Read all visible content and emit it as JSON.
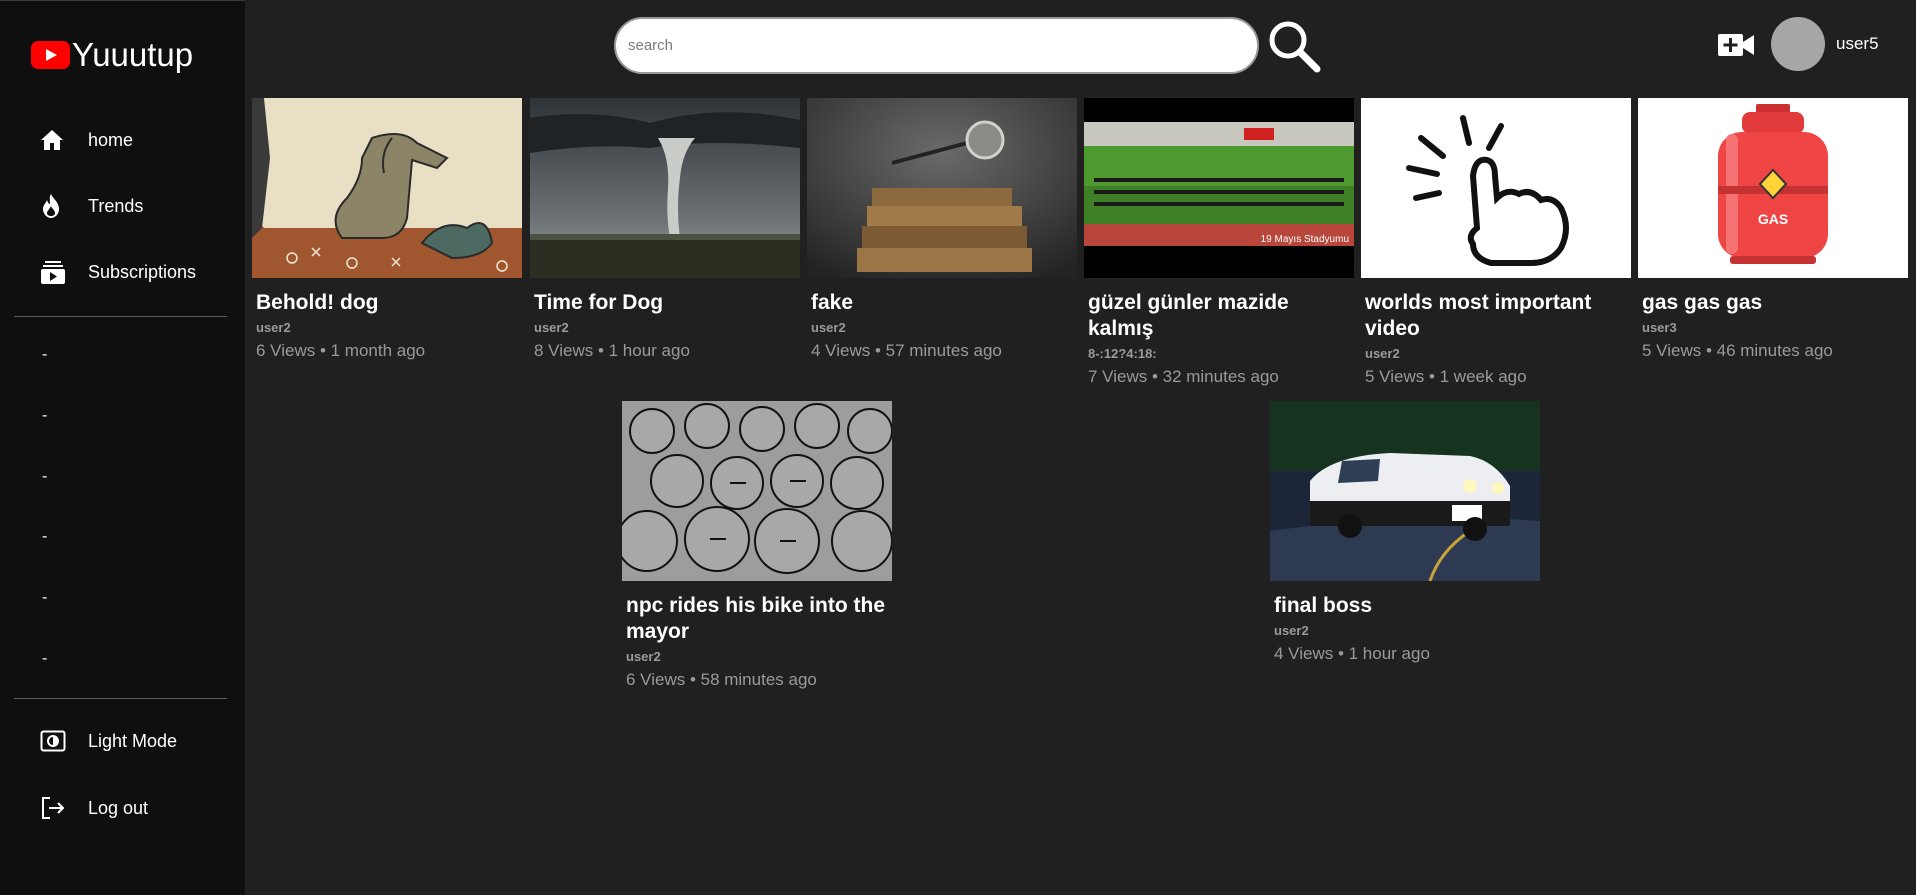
{
  "app": {
    "name": "Yuuutup"
  },
  "search": {
    "placeholder": "search"
  },
  "header": {
    "username": "user5"
  },
  "sidebar": {
    "items": [
      {
        "label": "home",
        "icon": "home-icon"
      },
      {
        "label": "Trends",
        "icon": "fire-icon"
      },
      {
        "label": "Subscriptions",
        "icon": "subscriptions-icon"
      }
    ],
    "subscriptions": [
      "-",
      "-",
      "-",
      "-",
      "-",
      "-"
    ],
    "bottom": [
      {
        "label": "Light Mode",
        "icon": "light-mode-icon"
      },
      {
        "label": "Log out",
        "icon": "logout-icon"
      }
    ]
  },
  "videos": [
    {
      "title": "Behold! dog",
      "channel": "user2",
      "meta": "6 Views • 1 month ago",
      "thumb": "dog-painting"
    },
    {
      "title": "Time for Dog",
      "channel": "user2",
      "meta": "8 Views • 1 hour ago",
      "thumb": "tornado"
    },
    {
      "title": "fake",
      "channel": "user2",
      "meta": "4 Views • 57 minutes ago",
      "thumb": "books-magnifier"
    },
    {
      "title": "güzel günler mazide kalmış",
      "channel": "8-:12?4:18:",
      "meta": "7 Views • 32 minutes ago",
      "thumb": "stadium",
      "thumb_caption": "19 Mayıs Stadyumu"
    },
    {
      "title": "worlds most important video",
      "channel": "user2",
      "meta": "5 Views • 1 week ago",
      "thumb": "click-hand"
    },
    {
      "title": "gas gas gas",
      "channel": "user3",
      "meta": "5 Views • 46 minutes ago",
      "thumb": "gas-cylinder",
      "thumb_caption": "GAS"
    },
    {
      "title": "npc rides his bike into the mayor",
      "channel": "user2",
      "meta": "6 Views • 58 minutes ago",
      "thumb": "npc-crowd"
    },
    {
      "title": "final boss",
      "channel": "user2",
      "meta": "4 Views • 1 hour ago",
      "thumb": "ae86-car"
    }
  ]
}
